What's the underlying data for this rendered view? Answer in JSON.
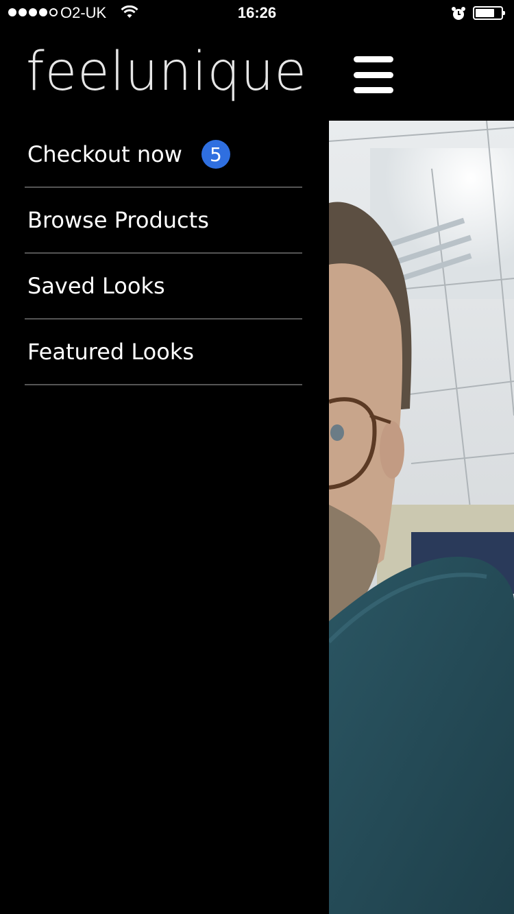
{
  "status_bar": {
    "carrier": "O2-UK",
    "time": "16:26",
    "signal_bars_filled": 4,
    "signal_bars_total": 5,
    "battery_level": 0.75
  },
  "header": {
    "logo": "feelunique",
    "menu_icon": "hamburger-icon"
  },
  "menu": {
    "items": [
      {
        "label": "Checkout now",
        "badge": "5"
      },
      {
        "label": "Browse Products"
      },
      {
        "label": "Saved Looks"
      },
      {
        "label": "Featured Looks"
      }
    ]
  },
  "colors": {
    "background": "#000000",
    "badge": "#2f6fe0",
    "divider": "#555555"
  },
  "camera_preview": {
    "subject": "camera-preview-image"
  }
}
